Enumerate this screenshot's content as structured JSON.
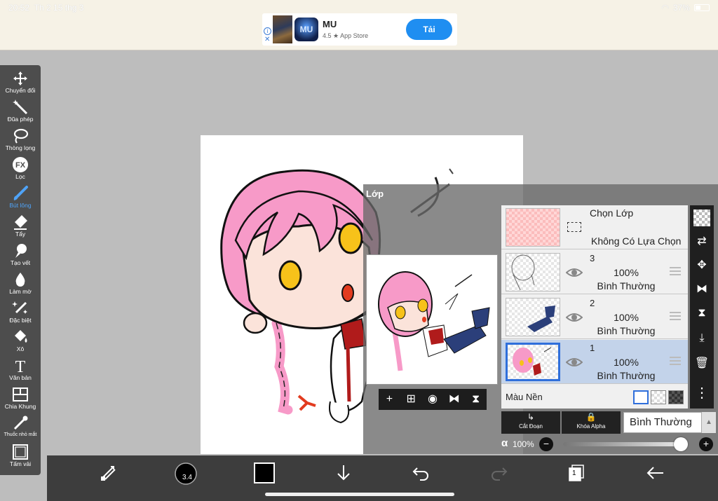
{
  "status": {
    "time": "20:52",
    "date": "Th 2 15 thg 3",
    "battery": "37%"
  },
  "ad": {
    "title": "MU",
    "rating": "4.5 ★ App Store",
    "button": "Tải",
    "logo_text": "MU"
  },
  "toolbar": {
    "tools": [
      {
        "label": "Chuyển đổi",
        "icon": "move-icon",
        "active": false
      },
      {
        "label": "Đũa phép",
        "icon": "magic-wand-icon",
        "active": false
      },
      {
        "label": "Thòng lọng",
        "icon": "lasso-icon",
        "active": false
      },
      {
        "label": "Lọc",
        "icon": "fx-filter-icon",
        "active": false
      },
      {
        "label": "Bút lông",
        "icon": "brush-icon",
        "active": true
      },
      {
        "label": "Tẩy",
        "icon": "eraser-icon",
        "active": false
      },
      {
        "label": "Tạo vết",
        "icon": "smudge-icon",
        "active": false
      },
      {
        "label": "Làm mờ",
        "icon": "blur-drop-icon",
        "active": false
      },
      {
        "label": "Đặc biệt",
        "icon": "special-pen-icon",
        "active": false
      },
      {
        "label": "Xô",
        "icon": "bucket-icon",
        "active": false
      },
      {
        "label": "Văn bản",
        "icon": "text-icon",
        "active": false
      },
      {
        "label": "Chia Khung",
        "icon": "frame-divider-icon",
        "active": false
      },
      {
        "label": "Thuốc nhỏ mắt",
        "icon": "eyedropper-icon",
        "active": false
      },
      {
        "label": "Tấm vải",
        "icon": "canvas-icon",
        "active": false
      }
    ]
  },
  "layer_panel": {
    "title": "Lớp",
    "selection_row": {
      "title": "Chọn Lớp",
      "subtitle": "Không Có Lựa Chọn"
    },
    "layers": [
      {
        "number": "3",
        "opacity": "100%",
        "mode": "Bình Thường",
        "selected": false,
        "visible": true
      },
      {
        "number": "2",
        "opacity": "100%",
        "mode": "Bình Thường",
        "selected": false,
        "visible": true
      },
      {
        "number": "1",
        "opacity": "100%",
        "mode": "Bình Thường",
        "selected": true,
        "visible": true
      }
    ],
    "background_label": "Màu Nền",
    "clip_label": "Cắt Đoạn",
    "alpha_lock_label": "Khóa Alpha",
    "blend_mode": "Bình Thường",
    "alpha_symbol": "α",
    "alpha_value": "100%",
    "alpha_fraction": 1.0
  },
  "bottom": {
    "brush_size": "3.4",
    "page_count": "1",
    "color": "#000000"
  },
  "colors": {
    "accent": "#4fa3f7",
    "selected_layer": "#c3d3ea",
    "ad_button": "#1f8ef1",
    "hair": "#f79ac8",
    "eye": "#f7c21a"
  }
}
